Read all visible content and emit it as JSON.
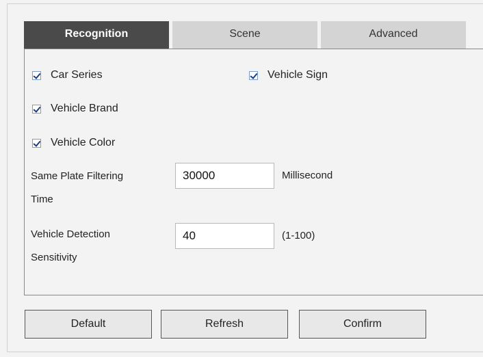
{
  "tabs": {
    "recognition": "Recognition",
    "scene": "Scene",
    "advanced": "Advanced"
  },
  "checkboxes": {
    "car_series": {
      "label": "Car Series",
      "checked": true
    },
    "vehicle_sign": {
      "label": "Vehicle Sign",
      "checked": true
    },
    "vehicle_brand": {
      "label": "Vehicle Brand",
      "checked": true
    },
    "vehicle_color": {
      "label": "Vehicle Color",
      "checked": true
    }
  },
  "fields": {
    "plate_filter": {
      "label_line1": "Same Plate Filtering",
      "label_line2": "Time",
      "value": "30000",
      "unit": "Millisecond"
    },
    "sensitivity": {
      "label_line1": "Vehicle Detection",
      "label_line2": "Sensitivity",
      "value": "40",
      "range": "(1-100)"
    }
  },
  "buttons": {
    "default": "Default",
    "refresh": "Refresh",
    "confirm": "Confirm"
  },
  "colors": {
    "active_tab": "#4a4a4a",
    "inactive_tab": "#d4d4d4",
    "background": "#f3f3f3"
  }
}
